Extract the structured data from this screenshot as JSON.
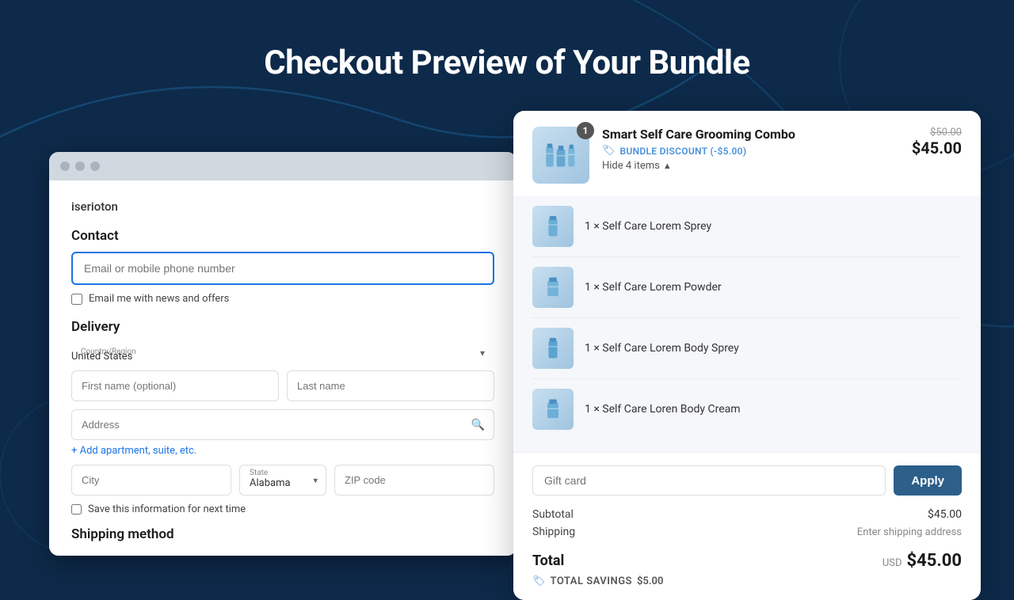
{
  "page": {
    "title": "Checkout Preview of Your Bundle",
    "background_color": "#0d2a4a"
  },
  "browser": {
    "store_name": "iserioton",
    "contact": {
      "label": "Contact",
      "input_placeholder": "Email or mobile phone number",
      "newsletter_label": "Email me with news and offers"
    },
    "delivery": {
      "label": "Delivery",
      "country_label": "Country/Region",
      "country_value": "United States",
      "first_name_placeholder": "First name (optional)",
      "last_name_placeholder": "Last name",
      "address_placeholder": "Address",
      "add_apartment_link": "+ Add apartment, suite, etc.",
      "city_placeholder": "City",
      "state_label": "State",
      "state_value": "Alabama",
      "zip_placeholder": "ZIP code",
      "save_info_label": "Save this information for next time"
    },
    "shipping_method_label": "Shipping method"
  },
  "order": {
    "bundle": {
      "badge": "1",
      "name": "Smart Self Care Grooming Combo",
      "discount_label": "BUNDLE DISCOUNT (-$5.00)",
      "hide_items_label": "Hide 4 items",
      "original_price": "$50.00",
      "sale_price": "$45.00"
    },
    "items": [
      {
        "name": "1 × Self Care Lorem Sprey"
      },
      {
        "name": "1 × Self Care Lorem Powder"
      },
      {
        "name": "1 × Self Care Lorem Body Sprey"
      },
      {
        "name": "1 × Self Care Loren Body Cream"
      }
    ],
    "gift_card_placeholder": "Gift card",
    "apply_button_label": "Apply",
    "subtotal_label": "Subtotal",
    "subtotal_value": "$45.00",
    "shipping_label": "Shipping",
    "shipping_value": "Enter shipping address",
    "total_label": "Total",
    "total_currency": "USD",
    "total_amount": "$45.00",
    "savings_label": "TOTAL SAVINGS",
    "savings_amount": "$5.00"
  }
}
